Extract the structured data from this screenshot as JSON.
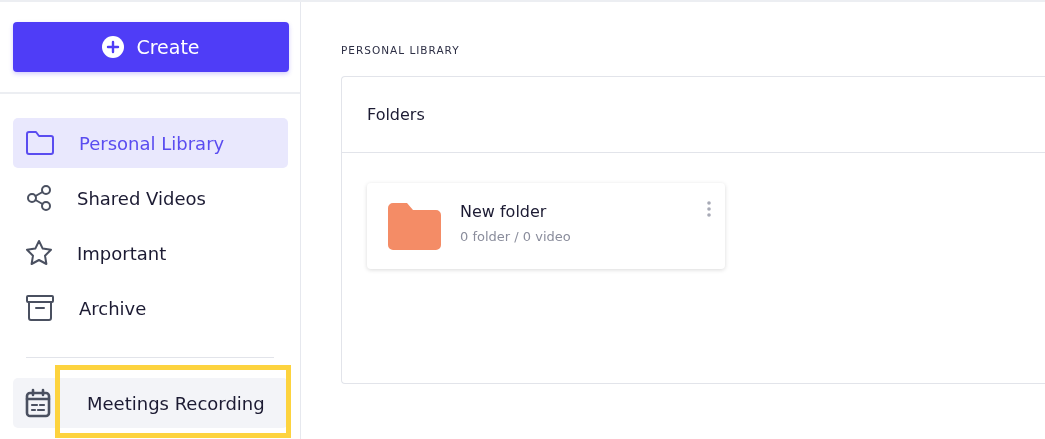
{
  "sidebar": {
    "create_button": {
      "label": "Create"
    },
    "items": [
      {
        "label": "Personal Library",
        "selected": true
      },
      {
        "label": "Shared Videos",
        "selected": false
      },
      {
        "label": "Important",
        "selected": false
      },
      {
        "label": "Archive",
        "selected": false
      }
    ],
    "bottom_items": [
      {
        "label": "Meetings Recording",
        "selected": false,
        "highlighted": true
      }
    ]
  },
  "main": {
    "section_title": "PERSONAL LIBRARY",
    "panel": {
      "title": "Folders",
      "folders": [
        {
          "name": "New folder",
          "meta": "0 folder / 0 video"
        }
      ]
    }
  }
}
